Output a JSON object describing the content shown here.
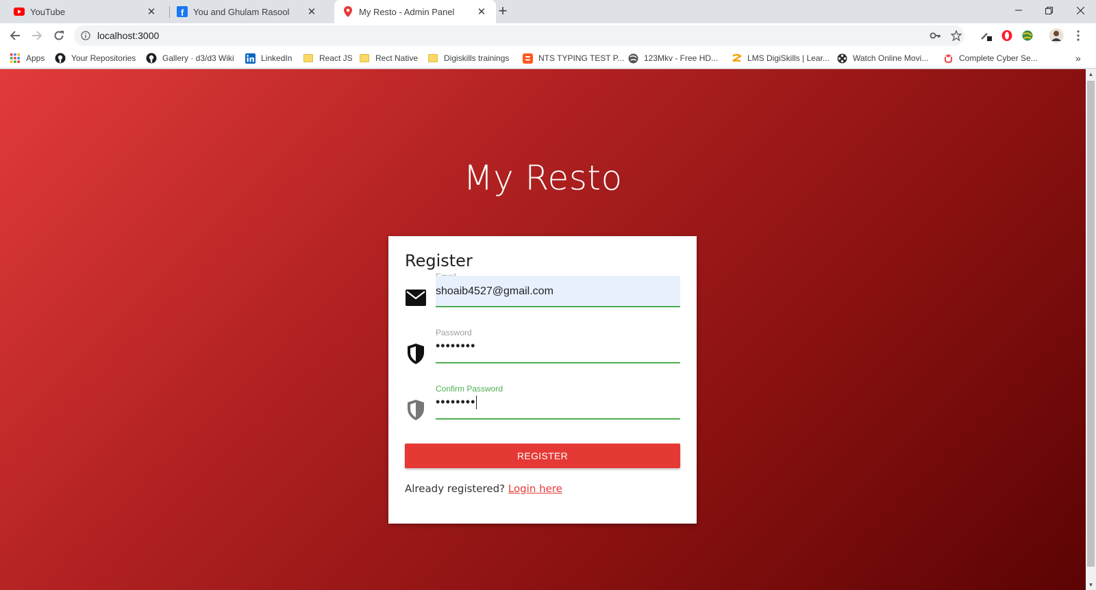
{
  "tabs": [
    {
      "title": "YouTube",
      "icon": "youtube-icon",
      "active": false
    },
    {
      "title": "You and Ghulam Rasool",
      "icon": "facebook-icon",
      "active": false
    },
    {
      "title": "My Resto - Admin Panel",
      "icon": "map-pin-icon",
      "active": true
    }
  ],
  "toolbar": {
    "url": "localhost:3000"
  },
  "bookmarks": [
    {
      "label": "Apps",
      "icon": "apps-grid-icon"
    },
    {
      "label": "Your Repositories",
      "icon": "github-icon"
    },
    {
      "label": "Gallery · d3/d3 Wiki",
      "icon": "github-icon"
    },
    {
      "label": "LinkedIn",
      "icon": "linkedin-icon"
    },
    {
      "label": "React JS",
      "icon": "folder-icon"
    },
    {
      "label": "Rect Native",
      "icon": "folder-icon"
    },
    {
      "label": "Digiskills trainings",
      "icon": "folder-icon"
    },
    {
      "label": "NTS TYPING TEST P...",
      "icon": "blogger-icon"
    },
    {
      "label": "123Mkv - Free HD...",
      "icon": "globe-icon"
    },
    {
      "label": "LMS DigiSkills | Lear...",
      "icon": "digiskills-icon"
    },
    {
      "label": "Watch Online Movi...",
      "icon": "film-reel-icon"
    },
    {
      "label": "Complete Cyber Se...",
      "icon": "udemy-icon"
    }
  ],
  "page": {
    "brand": "My Resto",
    "form": {
      "title": "Register",
      "email": {
        "label": "Email",
        "value": "shoaib4527@gmail.com"
      },
      "password": {
        "label": "Password",
        "value": "••••••••"
      },
      "confirm_password": {
        "label": "Confirm Password",
        "value": "••••••••"
      },
      "register_label": "REGISTER",
      "already_text": "Already registered?",
      "login_link": "Login here"
    }
  },
  "colors": {
    "gradient_start": "#e23b3b",
    "gradient_end": "#5c0303",
    "button": "#e53935",
    "field_underline": "#4caf50"
  }
}
